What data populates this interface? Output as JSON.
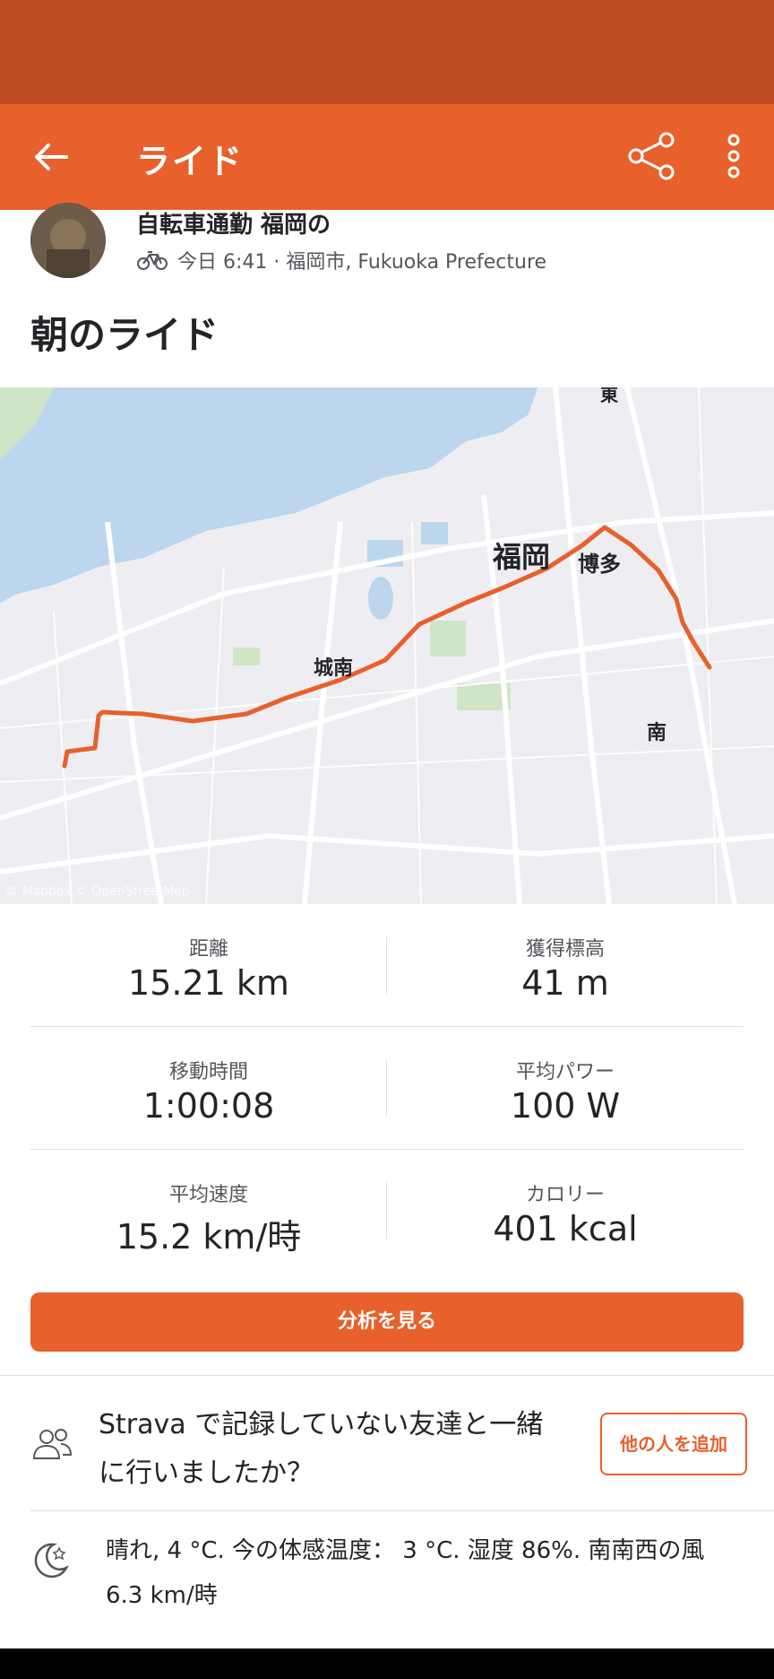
{
  "app_bar": {
    "title": "ライド",
    "back_icon": "arrow-left-icon",
    "share_icon": "share-icon",
    "more_icon": "more-vertical-icon"
  },
  "header": {
    "athlete_name": "自転車通勤 福岡の",
    "meta": "今日 6:41 · 福岡市, Fukuoka Prefecture",
    "bike_icon": "bike-icon"
  },
  "activity_title": "朝のライド",
  "map": {
    "labels": {
      "fukuoka": "福岡",
      "hakata": "博多",
      "jonan": "城南",
      "minami": "南",
      "higashi": "東"
    },
    "attribution": "© Mapbox © OpenStreetMap",
    "route_color": "#e8602c",
    "water_color": "#bcd6ee"
  },
  "stats": [
    {
      "label": "距離",
      "value": "15.21 km"
    },
    {
      "label": "獲得標高",
      "value": "41 m"
    },
    {
      "label": "移動時間",
      "value": "1:00:08"
    },
    {
      "label": "平均パワー",
      "value": "100 W"
    },
    {
      "label": "平均速度",
      "value": "15.2 km/時"
    },
    {
      "label": "カロリー",
      "value": "401 kcal"
    }
  ],
  "analyze_button": "分析を見る",
  "friends": {
    "text": "Strava で記録していない友達と一緒に行いましたか？",
    "add_button": "他の人を追加",
    "icon": "people-icon"
  },
  "weather": {
    "text": "晴れ, 4 °C. 今の体感温度： 3 °C. 湿度 86%. 南南西の風 6.3 km/時",
    "icon": "moon-star-icon"
  },
  "colors": {
    "accent": "#e8602c",
    "status_bar": "#bc4c21"
  }
}
